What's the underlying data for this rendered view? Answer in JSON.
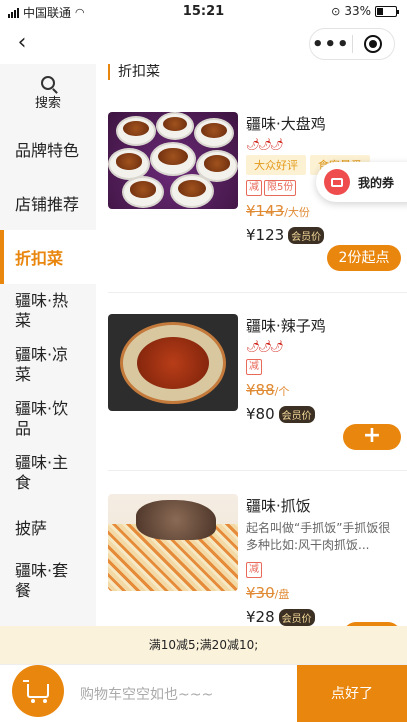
{
  "status_bar": {
    "carrier": "中国联通",
    "time": "15:21",
    "battery": "33%",
    "battery_level": 0.33
  },
  "nav": {
    "more_label": "•••"
  },
  "sidebar": {
    "search_label": "搜索",
    "items": [
      {
        "label": "品牌特色"
      },
      {
        "label": "店铺推荐"
      },
      {
        "label": "折扣菜"
      },
      {
        "label": "疆味·热菜"
      },
      {
        "label": "疆味·凉菜"
      },
      {
        "label": "疆味·饮品"
      },
      {
        "label": "疆味·主食"
      },
      {
        "label": "披萨"
      },
      {
        "label": "疆味·套餐"
      }
    ],
    "active_index": 2
  },
  "section": {
    "title": "折扣菜"
  },
  "dishes": [
    {
      "name": "疆味·大盘鸡",
      "spicy": "🌶🌶🌶",
      "tags": [
        "大众好评",
        "食客最爱"
      ],
      "badges": [
        "减",
        "限5份"
      ],
      "original_price": "¥143",
      "unit": "/大份",
      "price": "¥123",
      "vip_label": "会员价",
      "button": "2份起点"
    },
    {
      "name": "疆味·辣子鸡",
      "spicy": "🌶🌶🌶",
      "badges": [
        "减"
      ],
      "original_price": "¥88",
      "unit": "/个",
      "price": "¥80",
      "vip_label": "会员价",
      "button": "+"
    },
    {
      "name": "疆味·抓饭",
      "description": "起名叫做“手抓饭”手抓饭很多种比如:风干肉抓饭...",
      "badges": [
        "减"
      ],
      "original_price": "¥30",
      "unit": "/盘",
      "price": "¥28",
      "vip_label": "会员价"
    }
  ],
  "coupon": {
    "label": "我的券"
  },
  "promo": {
    "text": "满10减5;满20减10;"
  },
  "cart": {
    "empty_text": "购物车空空如也~~~",
    "checkout_label": "点好了"
  },
  "colors": {
    "accent": "#e9860d",
    "promo_bg": "#fbf2dc"
  }
}
